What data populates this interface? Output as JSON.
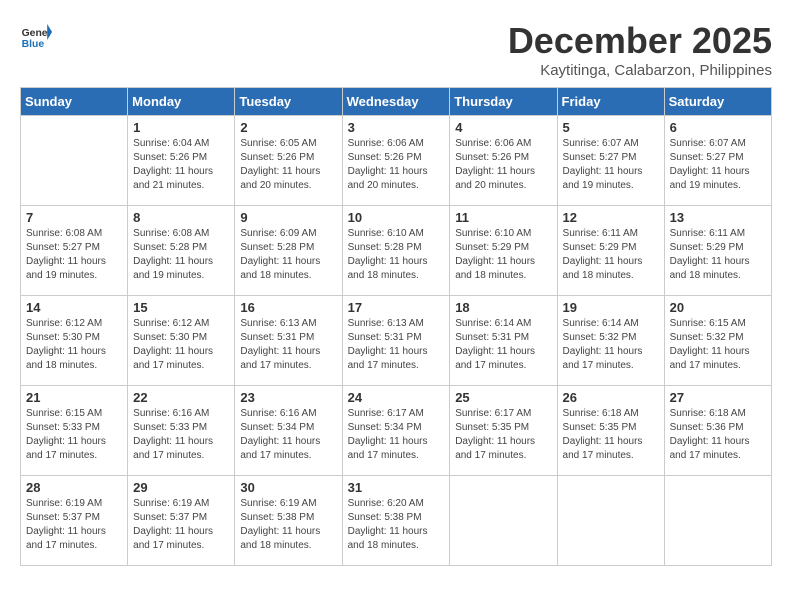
{
  "header": {
    "logo_general": "General",
    "logo_blue": "Blue",
    "title": "December 2025",
    "location": "Kaytitinga, Calabarzon, Philippines"
  },
  "calendar": {
    "days_of_week": [
      "Sunday",
      "Monday",
      "Tuesday",
      "Wednesday",
      "Thursday",
      "Friday",
      "Saturday"
    ],
    "weeks": [
      [
        {
          "day": "",
          "info": ""
        },
        {
          "day": "1",
          "info": "Sunrise: 6:04 AM\nSunset: 5:26 PM\nDaylight: 11 hours\nand 21 minutes."
        },
        {
          "day": "2",
          "info": "Sunrise: 6:05 AM\nSunset: 5:26 PM\nDaylight: 11 hours\nand 20 minutes."
        },
        {
          "day": "3",
          "info": "Sunrise: 6:06 AM\nSunset: 5:26 PM\nDaylight: 11 hours\nand 20 minutes."
        },
        {
          "day": "4",
          "info": "Sunrise: 6:06 AM\nSunset: 5:26 PM\nDaylight: 11 hours\nand 20 minutes."
        },
        {
          "day": "5",
          "info": "Sunrise: 6:07 AM\nSunset: 5:27 PM\nDaylight: 11 hours\nand 19 minutes."
        },
        {
          "day": "6",
          "info": "Sunrise: 6:07 AM\nSunset: 5:27 PM\nDaylight: 11 hours\nand 19 minutes."
        }
      ],
      [
        {
          "day": "7",
          "info": "Sunrise: 6:08 AM\nSunset: 5:27 PM\nDaylight: 11 hours\nand 19 minutes."
        },
        {
          "day": "8",
          "info": "Sunrise: 6:08 AM\nSunset: 5:28 PM\nDaylight: 11 hours\nand 19 minutes."
        },
        {
          "day": "9",
          "info": "Sunrise: 6:09 AM\nSunset: 5:28 PM\nDaylight: 11 hours\nand 18 minutes."
        },
        {
          "day": "10",
          "info": "Sunrise: 6:10 AM\nSunset: 5:28 PM\nDaylight: 11 hours\nand 18 minutes."
        },
        {
          "day": "11",
          "info": "Sunrise: 6:10 AM\nSunset: 5:29 PM\nDaylight: 11 hours\nand 18 minutes."
        },
        {
          "day": "12",
          "info": "Sunrise: 6:11 AM\nSunset: 5:29 PM\nDaylight: 11 hours\nand 18 minutes."
        },
        {
          "day": "13",
          "info": "Sunrise: 6:11 AM\nSunset: 5:29 PM\nDaylight: 11 hours\nand 18 minutes."
        }
      ],
      [
        {
          "day": "14",
          "info": "Sunrise: 6:12 AM\nSunset: 5:30 PM\nDaylight: 11 hours\nand 18 minutes."
        },
        {
          "day": "15",
          "info": "Sunrise: 6:12 AM\nSunset: 5:30 PM\nDaylight: 11 hours\nand 17 minutes."
        },
        {
          "day": "16",
          "info": "Sunrise: 6:13 AM\nSunset: 5:31 PM\nDaylight: 11 hours\nand 17 minutes."
        },
        {
          "day": "17",
          "info": "Sunrise: 6:13 AM\nSunset: 5:31 PM\nDaylight: 11 hours\nand 17 minutes."
        },
        {
          "day": "18",
          "info": "Sunrise: 6:14 AM\nSunset: 5:31 PM\nDaylight: 11 hours\nand 17 minutes."
        },
        {
          "day": "19",
          "info": "Sunrise: 6:14 AM\nSunset: 5:32 PM\nDaylight: 11 hours\nand 17 minutes."
        },
        {
          "day": "20",
          "info": "Sunrise: 6:15 AM\nSunset: 5:32 PM\nDaylight: 11 hours\nand 17 minutes."
        }
      ],
      [
        {
          "day": "21",
          "info": "Sunrise: 6:15 AM\nSunset: 5:33 PM\nDaylight: 11 hours\nand 17 minutes."
        },
        {
          "day": "22",
          "info": "Sunrise: 6:16 AM\nSunset: 5:33 PM\nDaylight: 11 hours\nand 17 minutes."
        },
        {
          "day": "23",
          "info": "Sunrise: 6:16 AM\nSunset: 5:34 PM\nDaylight: 11 hours\nand 17 minutes."
        },
        {
          "day": "24",
          "info": "Sunrise: 6:17 AM\nSunset: 5:34 PM\nDaylight: 11 hours\nand 17 minutes."
        },
        {
          "day": "25",
          "info": "Sunrise: 6:17 AM\nSunset: 5:35 PM\nDaylight: 11 hours\nand 17 minutes."
        },
        {
          "day": "26",
          "info": "Sunrise: 6:18 AM\nSunset: 5:35 PM\nDaylight: 11 hours\nand 17 minutes."
        },
        {
          "day": "27",
          "info": "Sunrise: 6:18 AM\nSunset: 5:36 PM\nDaylight: 11 hours\nand 17 minutes."
        }
      ],
      [
        {
          "day": "28",
          "info": "Sunrise: 6:19 AM\nSunset: 5:37 PM\nDaylight: 11 hours\nand 17 minutes."
        },
        {
          "day": "29",
          "info": "Sunrise: 6:19 AM\nSunset: 5:37 PM\nDaylight: 11 hours\nand 17 minutes."
        },
        {
          "day": "30",
          "info": "Sunrise: 6:19 AM\nSunset: 5:38 PM\nDaylight: 11 hours\nand 18 minutes."
        },
        {
          "day": "31",
          "info": "Sunrise: 6:20 AM\nSunset: 5:38 PM\nDaylight: 11 hours\nand 18 minutes."
        },
        {
          "day": "",
          "info": ""
        },
        {
          "day": "",
          "info": ""
        },
        {
          "day": "",
          "info": ""
        }
      ]
    ]
  }
}
